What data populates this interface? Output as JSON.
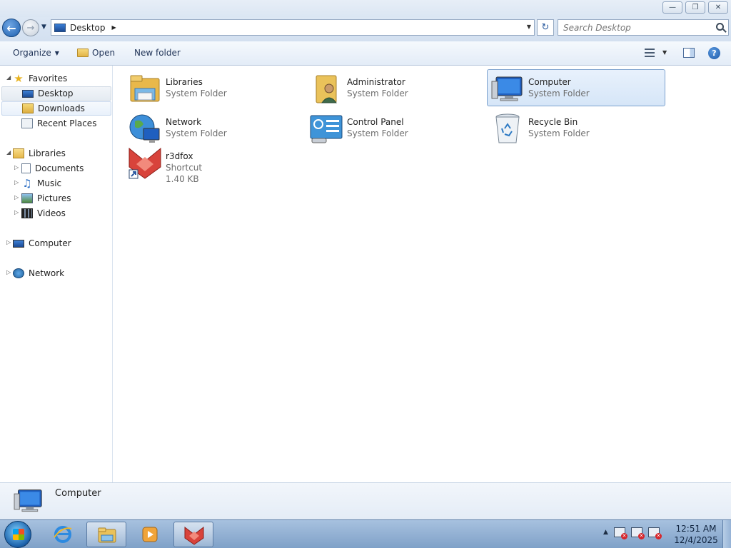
{
  "window": {
    "controls": {
      "minimize": "—",
      "maximize": "❐",
      "close": "✕"
    }
  },
  "address": {
    "location": "Desktop",
    "separator": "▶",
    "search_placeholder": "Search Desktop"
  },
  "toolbar": {
    "organize": "Organize",
    "open": "Open",
    "new_folder": "New folder",
    "help": "?"
  },
  "nav": {
    "favorites": {
      "label": "Favorites",
      "items": [
        "Desktop",
        "Downloads",
        "Recent Places"
      ]
    },
    "libraries": {
      "label": "Libraries",
      "items": [
        "Documents",
        "Music",
        "Pictures",
        "Videos"
      ]
    },
    "computer": "Computer",
    "network": "Network"
  },
  "items": [
    {
      "name": "Libraries",
      "type": "System Folder",
      "icon": "libraries-icon"
    },
    {
      "name": "Administrator",
      "type": "System Folder",
      "icon": "user-folder-icon"
    },
    {
      "name": "Computer",
      "type": "System Folder",
      "icon": "computer-icon",
      "selected": true
    },
    {
      "name": "Network",
      "type": "System Folder",
      "icon": "network-globe-icon"
    },
    {
      "name": "Control Panel",
      "type": "System Folder",
      "icon": "control-panel-icon"
    },
    {
      "name": "Recycle Bin",
      "type": "System Folder",
      "icon": "recycle-bin-icon"
    },
    {
      "name": "r3dfox",
      "type": "Shortcut",
      "size": "1.40 KB",
      "icon": "r3dfox-shortcut-icon"
    }
  ],
  "details": {
    "name": "Computer"
  },
  "taskbar": {
    "time": "12:51 AM",
    "date": "12/4/2025"
  },
  "colors": {
    "selection": "#d6e6f8",
    "selection_border": "#7da2ce",
    "taskbar": "#7fa1c8",
    "chrome": "#dce7f4"
  }
}
